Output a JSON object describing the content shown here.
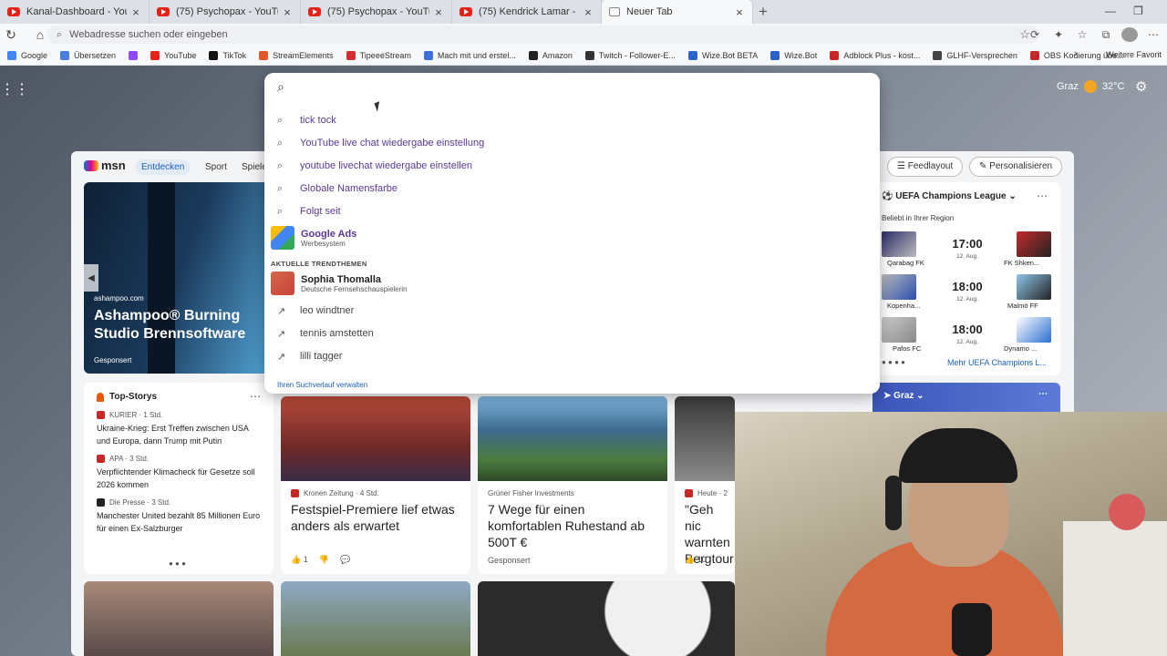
{
  "tabs": [
    {
      "label": "Kanal-Dashboard - YouTube Stud"
    },
    {
      "label": "(75) Psychopax - YouTube"
    },
    {
      "label": "(75) Psychopax - YouTube"
    },
    {
      "label": "(75) Kendrick Lamar - Not Like Us"
    },
    {
      "label": "Neuer Tab"
    }
  ],
  "address": {
    "placeholder": "Webadresse suchen oder eingeben"
  },
  "bookmarks": [
    {
      "label": "Google",
      "color": "#4285f4"
    },
    {
      "label": "Übersetzen",
      "color": "#4a7fe0"
    },
    {
      "label": "",
      "color": "#9146ff"
    },
    {
      "label": "YouTube",
      "color": "#e62117"
    },
    {
      "label": "TikTok",
      "color": "#111111"
    },
    {
      "label": "StreamElements",
      "color": "#e2562a"
    },
    {
      "label": "TipeeeStream",
      "color": "#d32f2f"
    },
    {
      "label": "Mach mit und erstel...",
      "color": "#3f6fd8"
    },
    {
      "label": "Amazon",
      "color": "#222222"
    },
    {
      "label": "Twitch - Follower-E...",
      "color": "#333333"
    },
    {
      "label": "Wize.Bot BETA",
      "color": "#2c62c9"
    },
    {
      "label": "Wize.Bot",
      "color": "#2c62c9"
    },
    {
      "label": "Adblock Plus - kost...",
      "color": "#c62828"
    },
    {
      "label": "GLHF-Versprechen",
      "color": "#444444"
    },
    {
      "label": "OBS Kodierung übe...",
      "color": "#c62828"
    }
  ],
  "bookmarks_more": "Weitere Favorit",
  "weather": {
    "city": "Graz",
    "temp": "32°C"
  },
  "msn": {
    "logo": "msn",
    "tabs": [
      "Entdecken",
      "Sport",
      "Spiele"
    ],
    "feedlayout": "Feedlayout",
    "personalize": "Personalisieren"
  },
  "hero": {
    "source": "ashampoo.com",
    "title": "Ashampoo® Burning Studio Brennsoftware",
    "sponsored": "Gesponsert"
  },
  "top_stories": {
    "title": "Top-Storys",
    "items": [
      {
        "source": "KURIER · 1 Std.",
        "headline": "Ukraine-Krieg: Erst Treffen zwischen USA und Europa, dann Trump mit Putin",
        "color": "#c62828"
      },
      {
        "source": "APA · 3 Std.",
        "headline": "Verpflichtender Klimacheck für Gesetze soll 2026 kommen",
        "color": "#c62828"
      },
      {
        "source": "Die Presse · 3 Std.",
        "headline": "Manchester United bezahlt 85 Millionen Euro für einen Ex-Salzburger",
        "color": "#222222"
      }
    ]
  },
  "cards": [
    {
      "source": "Kronen Zeitung · 4 Std.",
      "headline": "Festspiel-Premiere lief etwas anders als erwartet",
      "likes": "1"
    },
    {
      "source": "Grüner Fisher Investments",
      "headline": "7 Wege für einen komfortablen Ruhestand ab 500T €",
      "sponsored": "Gesponsert"
    },
    {
      "source": "Heute · 2",
      "headline": "\"Geh nic warnten Bergtour",
      "likes": "10"
    }
  ],
  "sports": {
    "league": "UEFA Champions League",
    "subtitle": "Beliebt in Ihrer Region",
    "matches": [
      {
        "home": "Qarabag FK",
        "away": "FK Shken...",
        "time": "17:00",
        "date": "12. Aug."
      },
      {
        "home": "Kopenha...",
        "away": "Malmö FF",
        "time": "18:00",
        "date": "12. Aug."
      },
      {
        "home": "Pafos FC",
        "away": "Dynamo ...",
        "time": "18:00",
        "date": "12. Aug."
      }
    ],
    "more": "Mehr UEFA Champions L..."
  },
  "graz_widget": "Graz",
  "dropdown": {
    "suggestions": [
      "tick tock",
      "YouTube live chat wiedergabe einstellung",
      "youtube livechat wiedergabe einstellen",
      "Globale Namensfarbe",
      "Folgt seit"
    ],
    "rich": {
      "title": "Google Ads",
      "subtitle": "Werbesystem"
    },
    "trend_header": "AKTUELLE TRENDTHEMEN",
    "trend_person": {
      "title": "Sophia Thomalla",
      "subtitle": "Deutsche Fernsehschauspielerin"
    },
    "trends": [
      "leo windtner",
      "tennis amstetten",
      "lilli tagger"
    ],
    "manage": "Ihren Suchverlauf verwalten"
  }
}
